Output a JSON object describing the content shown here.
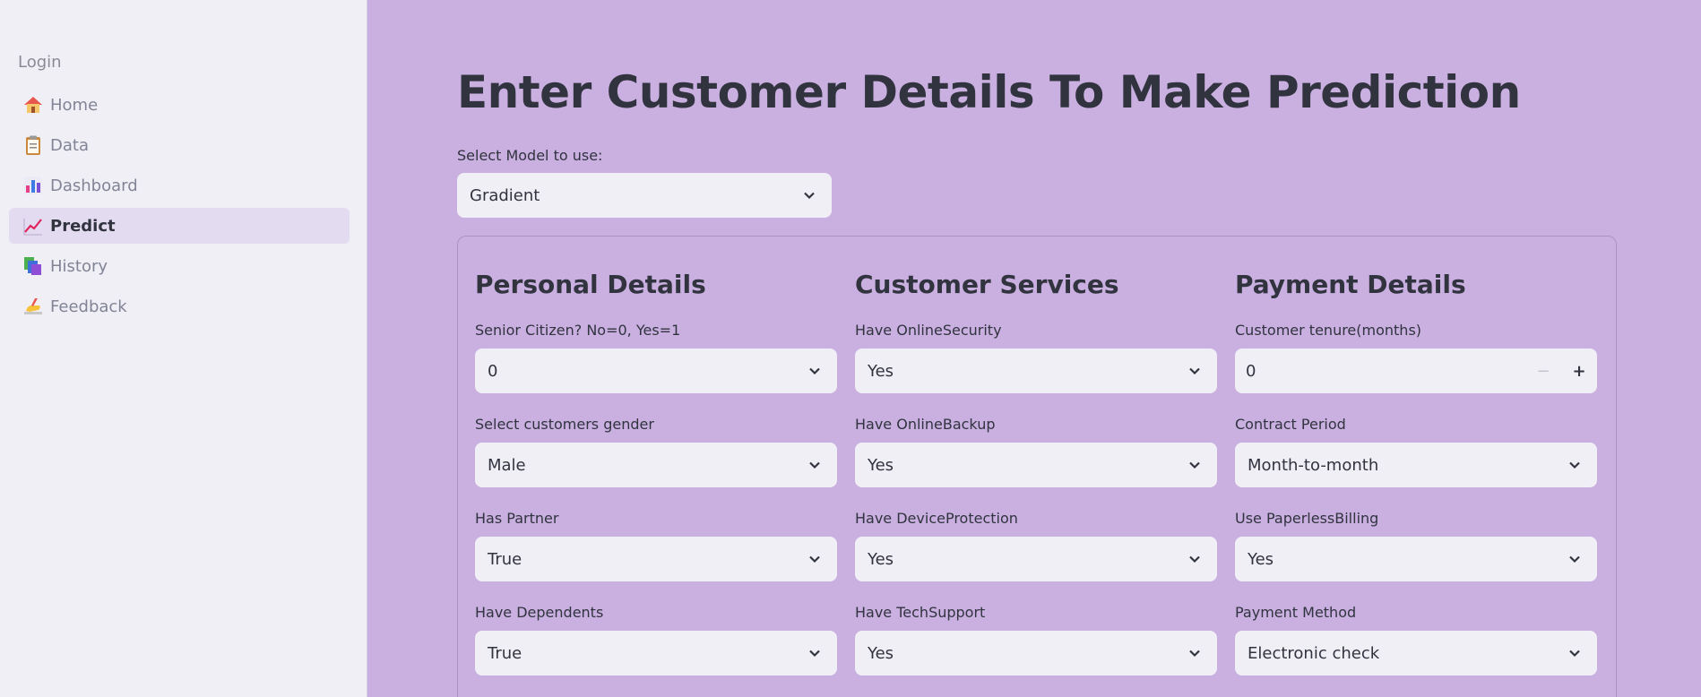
{
  "sidebar": {
    "login_label": "Login",
    "items": [
      {
        "label": "Home",
        "icon": "house-icon",
        "active": false
      },
      {
        "label": "Data",
        "icon": "clipboard-icon",
        "active": false
      },
      {
        "label": "Dashboard",
        "icon": "bar-chart-icon",
        "active": false
      },
      {
        "label": "Predict",
        "icon": "trend-chart-icon",
        "active": true
      },
      {
        "label": "History",
        "icon": "books-icon",
        "active": false
      },
      {
        "label": "Feedback",
        "icon": "writing-hand-icon",
        "active": false
      }
    ]
  },
  "main": {
    "title": "Enter Customer Details To Make Prediction",
    "model_select": {
      "label": "Select Model to use:",
      "value": "Gradient"
    }
  },
  "form": {
    "personal": {
      "title": "Personal Details",
      "senior": {
        "label": "Senior Citizen? No=0, Yes=1",
        "value": "0"
      },
      "gender": {
        "label": "Select customers gender",
        "value": "Male"
      },
      "partner": {
        "label": "Has Partner",
        "value": "True"
      },
      "dependents": {
        "label": "Have Dependents",
        "value": "True"
      }
    },
    "services": {
      "title": "Customer Services",
      "security": {
        "label": "Have OnlineSecurity",
        "value": "Yes"
      },
      "backup": {
        "label": "Have OnlineBackup",
        "value": "Yes"
      },
      "protection": {
        "label": "Have DeviceProtection",
        "value": "Yes"
      },
      "support": {
        "label": "Have TechSupport",
        "value": "Yes"
      }
    },
    "payment": {
      "title": "Payment Details",
      "tenure": {
        "label": "Customer tenure(months)",
        "value": "0",
        "minus": "−",
        "plus": "+"
      },
      "contract": {
        "label": "Contract Period",
        "value": "Month-to-month"
      },
      "paperless": {
        "label": "Use PaperlessBilling",
        "value": "Yes"
      },
      "method": {
        "label": "Payment Method",
        "value": "Electronic check"
      }
    }
  },
  "colors": {
    "background": "#c9b0e0",
    "sidebar": "#f1eff6",
    "input": "#f1eff6",
    "active_nav": "#e3dbef",
    "text": "#31333f"
  }
}
